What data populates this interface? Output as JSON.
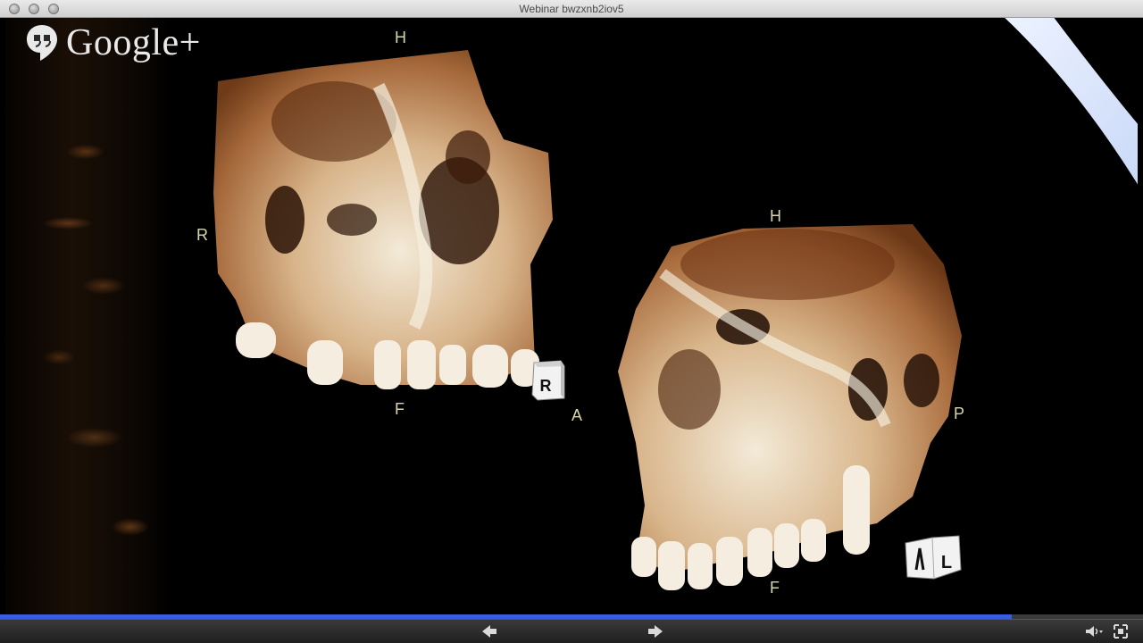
{
  "window": {
    "title": "Webinar bwzxnb2iov5"
  },
  "branding": {
    "logo_text": "Google+",
    "logo_icon": "hangouts-quote-icon"
  },
  "viewer": {
    "skull_1": {
      "labels": {
        "top": "H",
        "left": "R",
        "bottom": "F",
        "right": "A"
      },
      "cube_letter": "R"
    },
    "skull_2": {
      "labels": {
        "top": "H",
        "right": "P",
        "bottom": "F"
      },
      "cube_letter": "L"
    }
  },
  "playback": {
    "progress": 0.885,
    "accent_color": "#3a5ce0",
    "prev_icon": "arrow-left-icon",
    "next_icon": "arrow-right-icon",
    "volume_icon": "volume-icon",
    "fullscreen_icon": "fullscreen-icon"
  }
}
